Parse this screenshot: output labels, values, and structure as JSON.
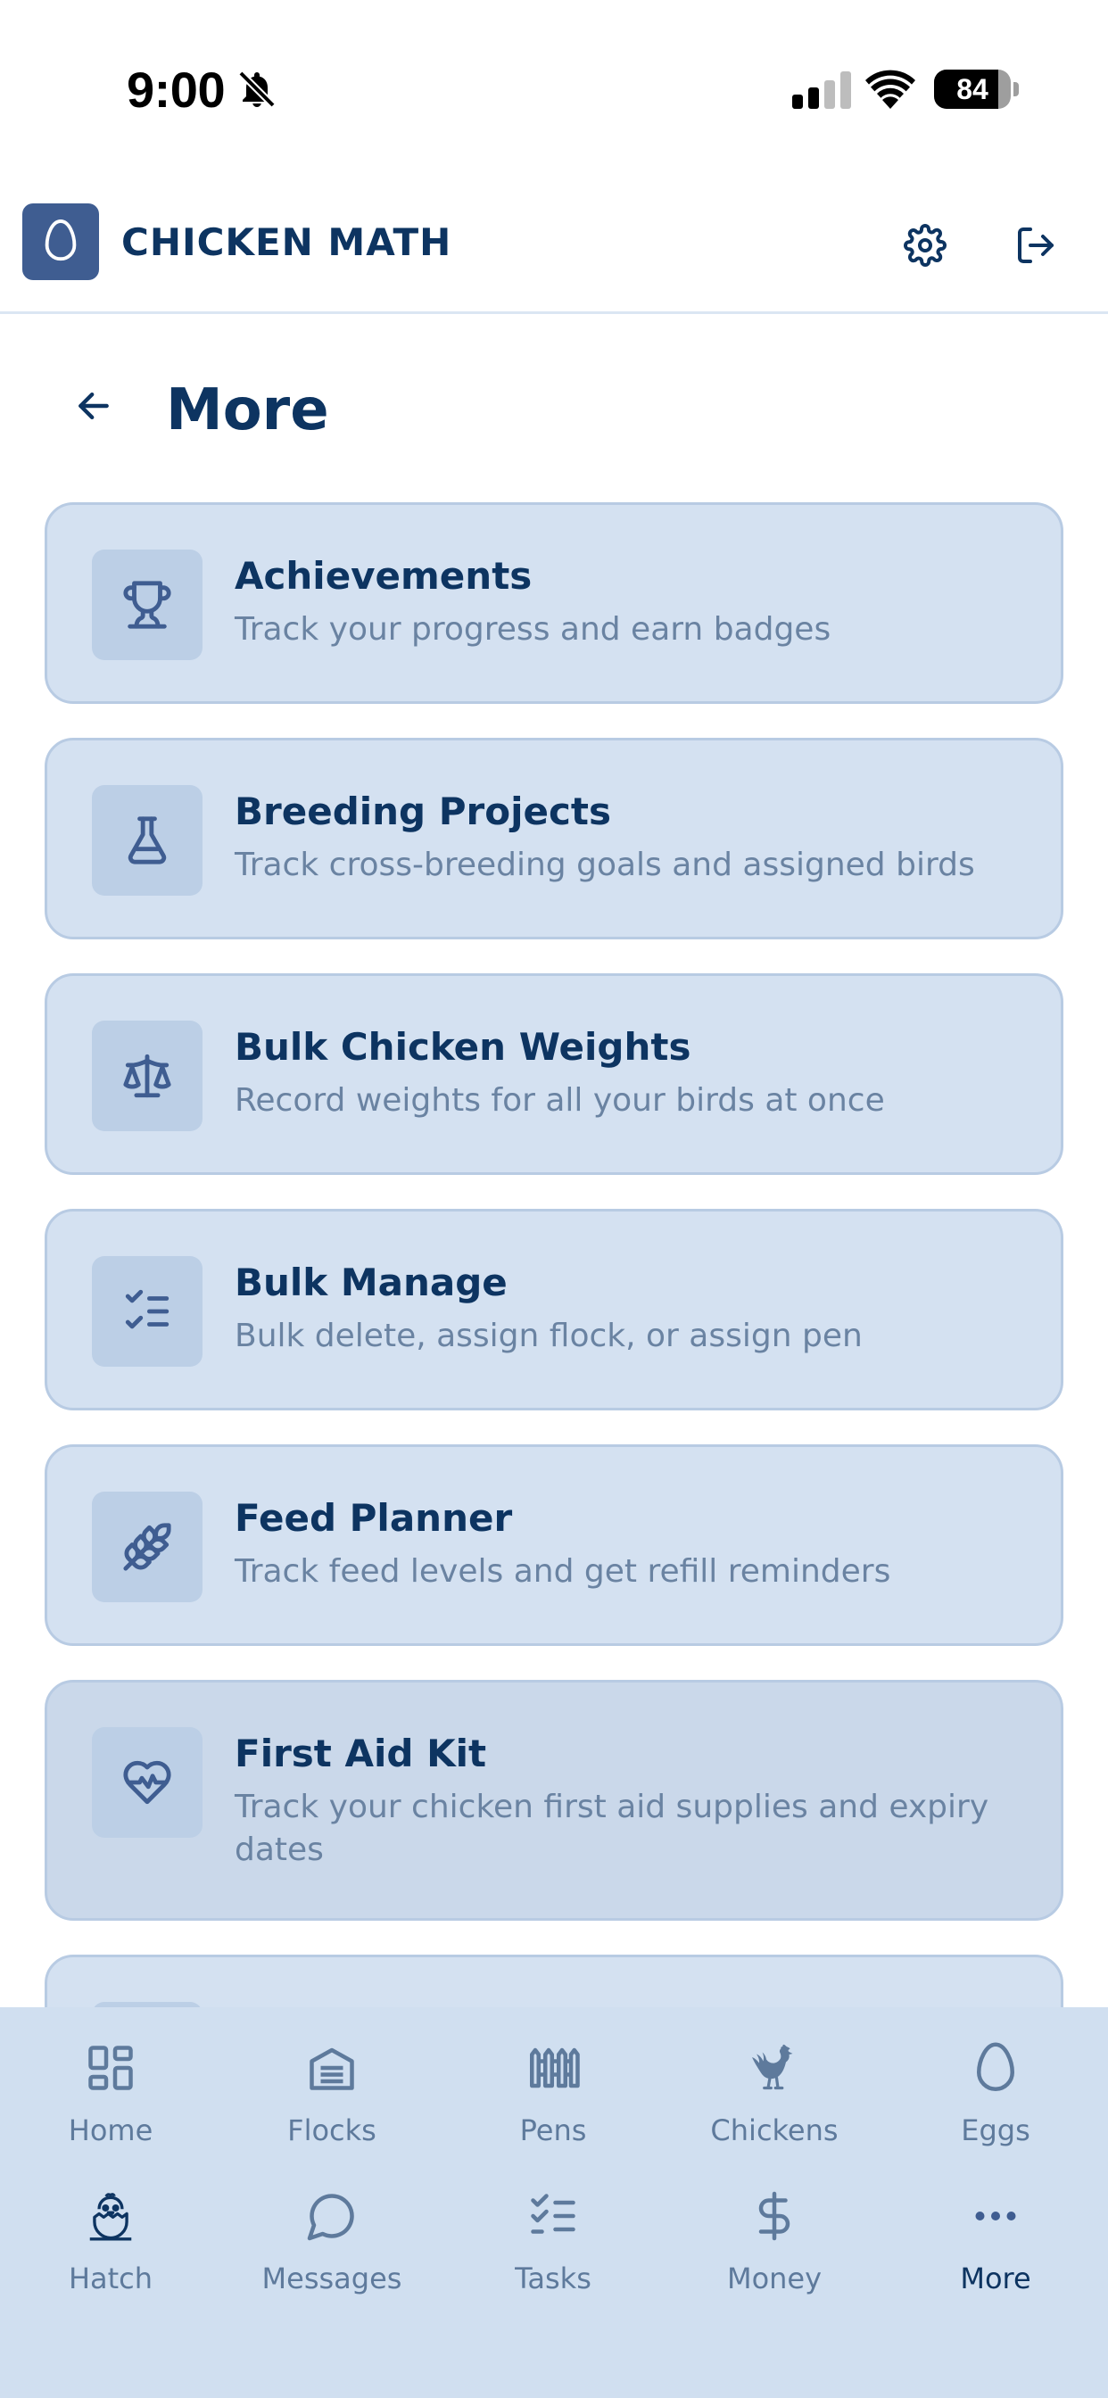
{
  "status_bar": {
    "time": "9:00",
    "battery": "84"
  },
  "header": {
    "app_title": "CHICKEN MATH"
  },
  "page": {
    "title": "More"
  },
  "cards": [
    {
      "title": "Achievements",
      "subtitle": "Track your progress and earn badges",
      "icon": "trophy-icon"
    },
    {
      "title": "Breeding Projects",
      "subtitle": "Track cross-breeding goals and assigned birds",
      "icon": "flask-icon"
    },
    {
      "title": "Bulk Chicken Weights",
      "subtitle": "Record weights for all your birds at once",
      "icon": "scale-icon"
    },
    {
      "title": "Bulk Manage",
      "subtitle": "Bulk delete, assign flock, or assign pen",
      "icon": "checklist-icon"
    },
    {
      "title": "Feed Planner",
      "subtitle": "Track feed levels and get refill reminders",
      "icon": "wheat-icon"
    },
    {
      "title": "First Aid Kit",
      "subtitle": "Track your chicken first aid supplies and expiry dates",
      "icon": "heart-pulse-icon"
    }
  ],
  "nav": {
    "row1": [
      {
        "label": "Home",
        "icon": "dashboard-icon"
      },
      {
        "label": "Flocks",
        "icon": "barn-icon"
      },
      {
        "label": "Pens",
        "icon": "fence-icon"
      },
      {
        "label": "Chickens",
        "icon": "rooster-icon"
      },
      {
        "label": "Eggs",
        "icon": "egg-icon"
      }
    ],
    "row2": [
      {
        "label": "Hatch",
        "icon": "hatching-chick-icon"
      },
      {
        "label": "Messages",
        "icon": "chat-bubble-icon"
      },
      {
        "label": "Tasks",
        "icon": "task-list-icon"
      },
      {
        "label": "Money",
        "icon": "dollar-icon"
      },
      {
        "label": "More",
        "icon": "more-dots-icon"
      }
    ],
    "selected": "More"
  },
  "colors": {
    "primary": "#0d3461",
    "card_bg": "#d4e1f1",
    "nav_bg": "#d0dff0",
    "logo_bg": "#3f5d91"
  }
}
